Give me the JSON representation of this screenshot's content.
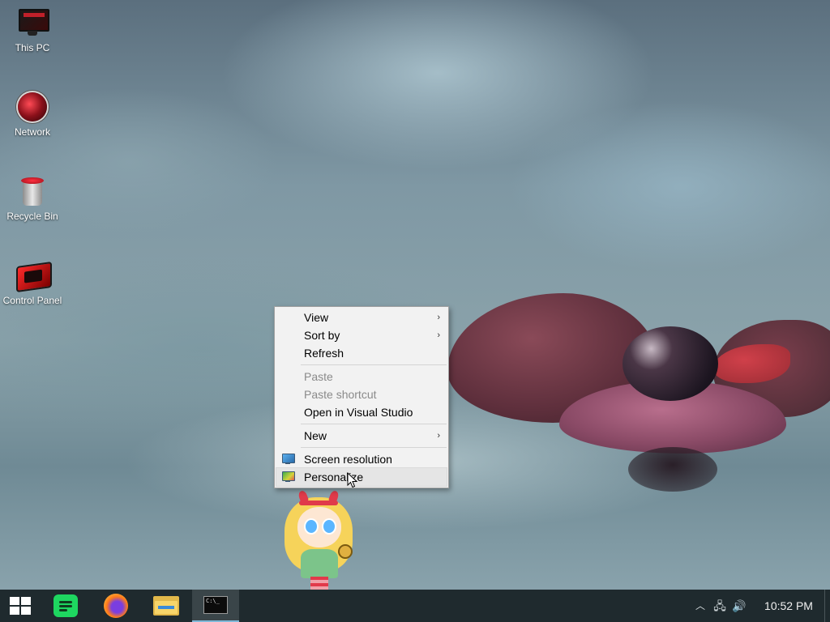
{
  "desktop": {
    "icons": [
      {
        "label": "This PC",
        "icon": "monitor-icon"
      },
      {
        "label": "Network",
        "icon": "network-icon"
      },
      {
        "label": "Recycle Bin",
        "icon": "recycle-bin-icon"
      },
      {
        "label": "Control Panel",
        "icon": "control-panel-icon"
      }
    ]
  },
  "context_menu": {
    "view": "View",
    "sort_by": "Sort by",
    "refresh": "Refresh",
    "paste": "Paste",
    "paste_shortcut": "Paste shortcut",
    "open_in_vs": "Open in Visual Studio",
    "new": "New",
    "screen_resolution": "Screen resolution",
    "personalize": "Personalize",
    "submenu_arrow": "›",
    "hovered_item": "Personalize"
  },
  "taskbar": {
    "apps": [
      {
        "name": "start",
        "icon": "windows-logo-icon"
      },
      {
        "name": "spotify",
        "icon": "spotify-icon"
      },
      {
        "name": "firefox",
        "icon": "firefox-icon"
      },
      {
        "name": "file-explorer",
        "icon": "folder-icon"
      },
      {
        "name": "command-prompt",
        "icon": "terminal-icon",
        "active": true
      }
    ],
    "cmd_glyph_text": "C:\\_",
    "tray": {
      "chevron": "︿",
      "network": "🖧",
      "volume": "🔊"
    },
    "clock": "10:52 PM"
  },
  "colors": {
    "taskbar_bg": "#1f2a2e",
    "menu_bg": "#f2f2f2",
    "menu_highlight": "#e5e5e5",
    "disabled_text": "#8a8a8a"
  }
}
